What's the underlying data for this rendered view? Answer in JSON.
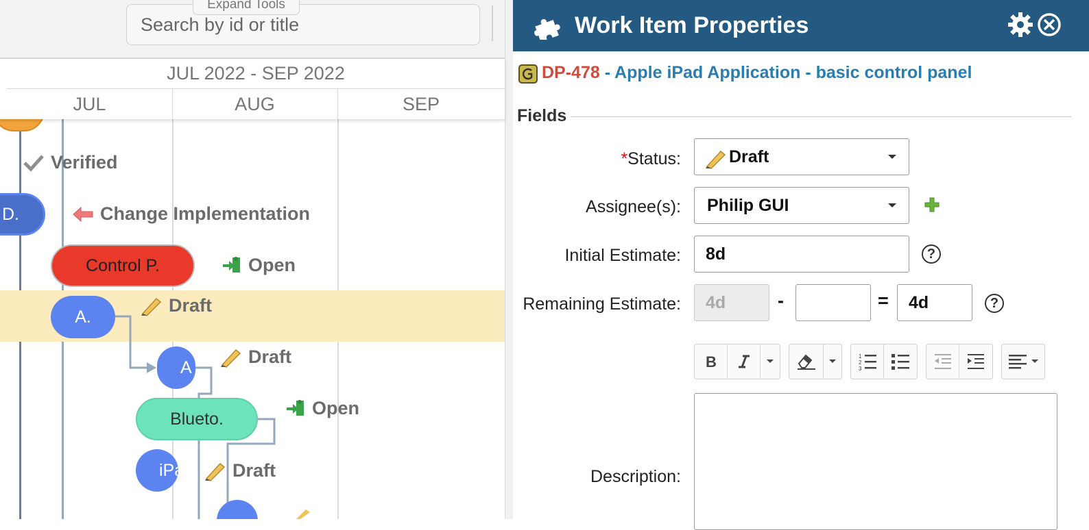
{
  "toolbar": {
    "search_placeholder": "Search by id or title",
    "expand_tools_label": "Expand Tools"
  },
  "timeline": {
    "quarter_label": "JUL 2022 - SEP 2022",
    "months": [
      "JUL",
      "AUG",
      "SEP"
    ]
  },
  "gantt": {
    "bars": [
      {
        "label": "D.",
        "color": "#4a6fc9"
      },
      {
        "label": "Control P.",
        "color": "#e8392a"
      },
      {
        "label": "A.",
        "color": "#5b84f0"
      },
      {
        "label": "A",
        "color": "#5b84f0"
      },
      {
        "label": "Blueto.",
        "color": "#6de3bb"
      },
      {
        "label": "iPa",
        "color": "#5b84f0"
      }
    ],
    "statuses": [
      {
        "label": "Verified",
        "icon": "check-icon"
      },
      {
        "label": "Change Implementation",
        "icon": "arrow-left-icon"
      },
      {
        "label": "Open",
        "icon": "open-door-icon"
      },
      {
        "label": "Draft",
        "icon": "pencil-icon"
      },
      {
        "label": "Draft",
        "icon": "pencil-icon"
      },
      {
        "label": "Open",
        "icon": "open-door-icon"
      },
      {
        "label": "Draft",
        "icon": "pencil-icon"
      }
    ]
  },
  "panel": {
    "title": "Work Item Properties",
    "header_color": "#245a82",
    "item_id": "DP-478",
    "item_title": " - Apple iPad Application - basic control panel",
    "fields_legend": "Fields",
    "status": {
      "required_mark": "*",
      "label": "Status:",
      "value": "Draft"
    },
    "assignee": {
      "label": "Assignee(s):",
      "value": "Philip GUI"
    },
    "initial_estimate": {
      "label": "Initial Estimate:",
      "value": "8d"
    },
    "remaining_estimate": {
      "label": "Remaining Estimate:",
      "value_left": "4d",
      "minus": "-",
      "value_mid": "",
      "equals": "=",
      "value_right": "4d"
    },
    "help_glyph": "?",
    "description_label": "Description:"
  }
}
